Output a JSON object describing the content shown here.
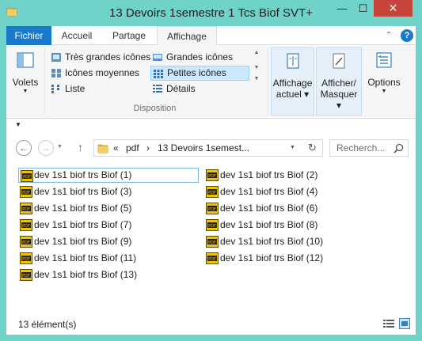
{
  "window": {
    "title": "13 Devoirs 1semestre 1 Tcs Biof SVT+",
    "minimize_glyph": "—",
    "maximize_glyph": "☐",
    "close_glyph": "✕"
  },
  "ribbon_tabs": [
    {
      "label": "Fichier"
    },
    {
      "label": "Accueil"
    },
    {
      "label": "Partage"
    },
    {
      "label": "Affichage"
    }
  ],
  "ribbon_controls": {
    "collapse_glyph": "⌃",
    "help_glyph": "?"
  },
  "ribbon": {
    "volets": {
      "label": "Volets"
    },
    "layout_items": [
      {
        "label": "Très grandes icônes"
      },
      {
        "label": "Grandes icônes"
      },
      {
        "label": "Icônes moyennes"
      },
      {
        "label": "Petites icônes"
      },
      {
        "label": "Liste"
      },
      {
        "label": "Détails"
      }
    ],
    "group_label": "Disposition",
    "affichage_actuel": {
      "line1": "Affichage",
      "line2": "actuel ▾"
    },
    "afficher_masquer": {
      "line1": "Afficher/",
      "line2": "Masquer ▾"
    },
    "options": {
      "label": "Options"
    }
  },
  "nav": {
    "back_glyph": "←",
    "forward_glyph": "→",
    "up_glyph": "↑"
  },
  "address": {
    "overflow": "«",
    "crumbs": [
      "pdf",
      "13 Devoirs 1semest..."
    ],
    "separator": "›",
    "refresh_glyph": "↻"
  },
  "search": {
    "placeholder": "Recherch..."
  },
  "files": [
    {
      "name": "dev 1s1 biof trs Biof (1)"
    },
    {
      "name": "dev 1s1 biof trs Biof (2)"
    },
    {
      "name": "dev 1s1 biof trs Biof (3)"
    },
    {
      "name": "dev 1s1 biof trs Biof (4)"
    },
    {
      "name": "dev 1s1 biof trs Biof (5)"
    },
    {
      "name": "dev 1s1 biof trs Biof (6)"
    },
    {
      "name": "dev 1s1 biof trs Biof (7)"
    },
    {
      "name": "dev 1s1 biof trs Biof (8)"
    },
    {
      "name": "dev 1s1 biof trs Biof (9)"
    },
    {
      "name": "dev 1s1 biof trs Biof (10)"
    },
    {
      "name": "dev 1s1 biof trs Biof (11)"
    },
    {
      "name": "dev 1s1 biof trs Biof (12)"
    },
    {
      "name": "dev 1s1 biof trs Biof (13)"
    }
  ],
  "status": {
    "count_text": "13 élément(s)"
  },
  "colors": {
    "frame": "#6fd3ca",
    "accent": "#1979ca",
    "close": "#c7443c",
    "selection": "#cce8ff",
    "folder": "#e8b84b"
  }
}
